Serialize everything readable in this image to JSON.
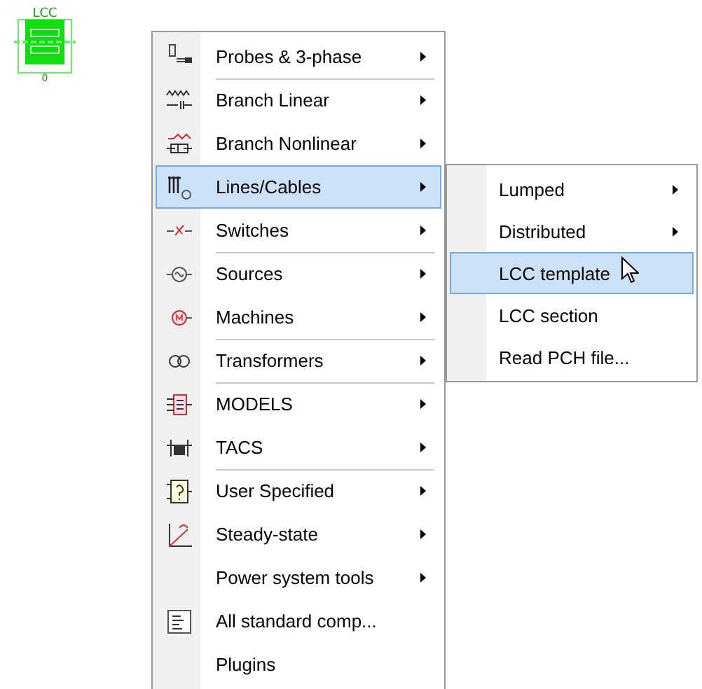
{
  "component": {
    "label": "LCC",
    "node": "0"
  },
  "menu": {
    "items": [
      {
        "label": "Probes & 3-phase",
        "submenu": true,
        "selected": false,
        "separator_after": true
      },
      {
        "label": "Branch Linear",
        "submenu": true,
        "selected": false,
        "separator_after": false
      },
      {
        "label": "Branch Nonlinear",
        "submenu": true,
        "selected": false,
        "separator_after": false
      },
      {
        "label": "Lines/Cables",
        "submenu": true,
        "selected": true,
        "separator_after": false
      },
      {
        "label": "Switches",
        "submenu": true,
        "selected": false,
        "separator_after": true
      },
      {
        "label": "Sources",
        "submenu": true,
        "selected": false,
        "separator_after": false
      },
      {
        "label": "Machines",
        "submenu": true,
        "selected": false,
        "separator_after": true
      },
      {
        "label": "Transformers",
        "submenu": true,
        "selected": false,
        "separator_after": true
      },
      {
        "label": "MODELS",
        "submenu": true,
        "selected": false,
        "separator_after": false
      },
      {
        "label": "TACS",
        "submenu": true,
        "selected": false,
        "separator_after": true
      },
      {
        "label": "User Specified",
        "submenu": true,
        "selected": false,
        "separator_after": false
      },
      {
        "label": "Steady-state",
        "submenu": true,
        "selected": false,
        "separator_after": false
      },
      {
        "label": "Power system tools",
        "submenu": true,
        "selected": false,
        "separator_after": false
      },
      {
        "label": "All standard comp...",
        "submenu": false,
        "selected": false,
        "separator_after": false
      },
      {
        "label": "Plugins",
        "submenu": false,
        "selected": false,
        "separator_after": false
      }
    ]
  },
  "submenu": {
    "items": [
      {
        "label": "Lumped",
        "submenu": true,
        "selected": false
      },
      {
        "label": "Distributed",
        "submenu": true,
        "selected": false
      },
      {
        "label": "LCC template",
        "submenu": false,
        "selected": true
      },
      {
        "label": "LCC section",
        "submenu": false,
        "selected": false
      },
      {
        "label": "Read PCH file...",
        "submenu": false,
        "selected": false
      }
    ]
  }
}
